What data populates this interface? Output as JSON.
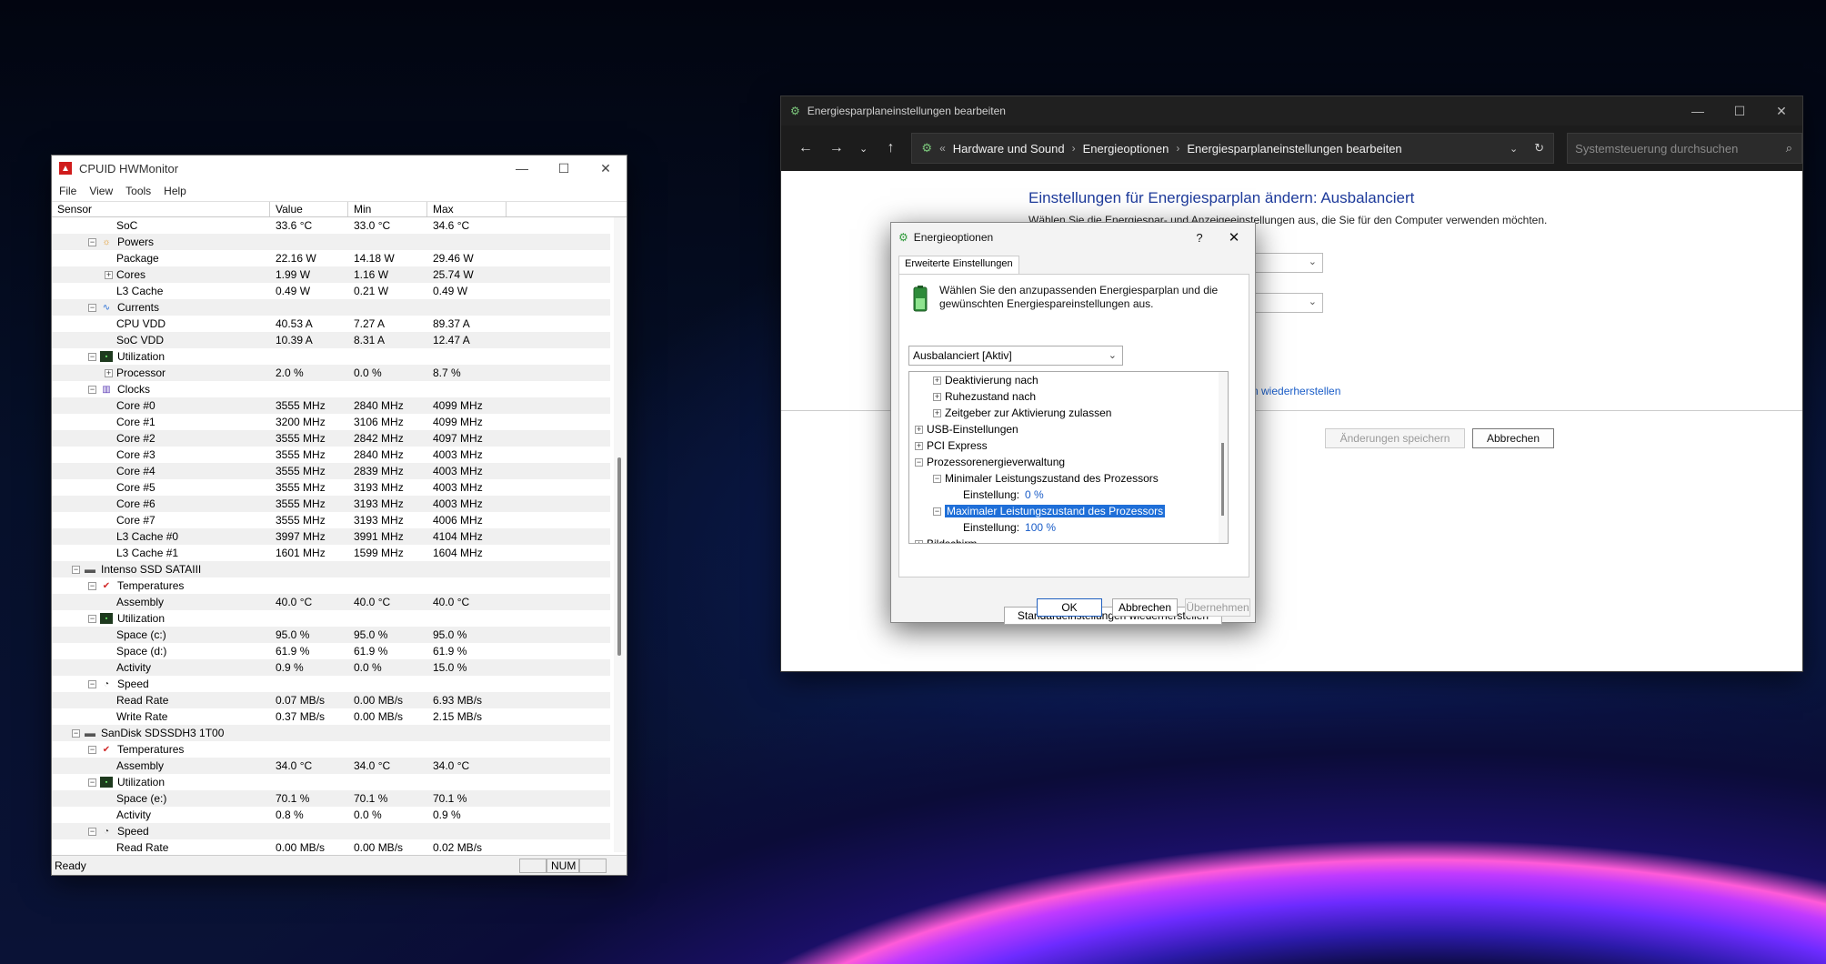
{
  "hwmonitor": {
    "title": "CPUID HWMonitor",
    "menu": [
      "File",
      "View",
      "Tools",
      "Help"
    ],
    "columns": [
      "Sensor",
      "Value",
      "Min",
      "Max"
    ],
    "rows": [
      {
        "indent": 3,
        "label": "SoC",
        "value": "33.6 °C",
        "min": "33.0 °C",
        "max": "34.6 °C"
      },
      {
        "indent": 2,
        "exp": "-",
        "icon": "powers-icon",
        "glyph": "☼",
        "cls": "pow",
        "label": "Powers",
        "value": "",
        "min": "",
        "max": ""
      },
      {
        "indent": 3,
        "label": "Package",
        "value": "22.16 W",
        "min": "14.18 W",
        "max": "29.46 W"
      },
      {
        "indent": 3,
        "exp": "+",
        "label": "Cores",
        "value": "1.99 W",
        "min": "1.16 W",
        "max": "25.74 W"
      },
      {
        "indent": 3,
        "label": "L3 Cache",
        "value": "0.49 W",
        "min": "0.21 W",
        "max": "0.49 W"
      },
      {
        "indent": 2,
        "exp": "-",
        "icon": "currents-icon",
        "glyph": "∿",
        "cls": "cur",
        "label": "Currents",
        "value": "",
        "min": "",
        "max": ""
      },
      {
        "indent": 3,
        "label": "CPU VDD",
        "value": "40.53 A",
        "min": "7.27 A",
        "max": "89.37 A"
      },
      {
        "indent": 3,
        "label": "SoC VDD",
        "value": "10.39 A",
        "min": "8.31 A",
        "max": "12.47 A"
      },
      {
        "indent": 2,
        "exp": "-",
        "icon": "utilization-icon",
        "glyph": "▪",
        "cls": "util",
        "label": "Utilization",
        "value": "",
        "min": "",
        "max": ""
      },
      {
        "indent": 3,
        "exp": "+",
        "label": "Processor",
        "value": "2.0 %",
        "min": "0.0 %",
        "max": "8.7 %"
      },
      {
        "indent": 2,
        "exp": "-",
        "icon": "clocks-icon",
        "glyph": "▥",
        "cls": "clk",
        "label": "Clocks",
        "value": "",
        "min": "",
        "max": ""
      },
      {
        "indent": 3,
        "label": "Core #0",
        "value": "3555 MHz",
        "min": "2840 MHz",
        "max": "4099 MHz"
      },
      {
        "indent": 3,
        "label": "Core #1",
        "value": "3200 MHz",
        "min": "3106 MHz",
        "max": "4099 MHz"
      },
      {
        "indent": 3,
        "label": "Core #2",
        "value": "3555 MHz",
        "min": "2842 MHz",
        "max": "4097 MHz"
      },
      {
        "indent": 3,
        "label": "Core #3",
        "value": "3555 MHz",
        "min": "2840 MHz",
        "max": "4003 MHz"
      },
      {
        "indent": 3,
        "label": "Core #4",
        "value": "3555 MHz",
        "min": "2839 MHz",
        "max": "4003 MHz"
      },
      {
        "indent": 3,
        "label": "Core #5",
        "value": "3555 MHz",
        "min": "3193 MHz",
        "max": "4003 MHz"
      },
      {
        "indent": 3,
        "label": "Core #6",
        "value": "3555 MHz",
        "min": "3193 MHz",
        "max": "4003 MHz"
      },
      {
        "indent": 3,
        "label": "Core #7",
        "value": "3555 MHz",
        "min": "3193 MHz",
        "max": "4006 MHz"
      },
      {
        "indent": 3,
        "label": "L3 Cache #0",
        "value": "3997 MHz",
        "min": "3991 MHz",
        "max": "4104 MHz"
      },
      {
        "indent": 3,
        "label": "L3 Cache #1",
        "value": "1601 MHz",
        "min": "1599 MHz",
        "max": "1604 MHz"
      },
      {
        "indent": 1,
        "exp": "-",
        "icon": "drive-icon",
        "glyph": "▬",
        "cls": "disk",
        "label": "Intenso SSD SATAIII",
        "value": "",
        "min": "",
        "max": ""
      },
      {
        "indent": 2,
        "exp": "-",
        "icon": "temperature-icon",
        "glyph": "✔",
        "cls": "temp",
        "label": "Temperatures",
        "value": "",
        "min": "",
        "max": ""
      },
      {
        "indent": 3,
        "label": "Assembly",
        "value": "40.0 °C",
        "min": "40.0 °C",
        "max": "40.0 °C"
      },
      {
        "indent": 2,
        "exp": "-",
        "icon": "utilization-icon",
        "glyph": "▪",
        "cls": "util",
        "label": "Utilization",
        "value": "",
        "min": "",
        "max": ""
      },
      {
        "indent": 3,
        "label": "Space (c:)",
        "value": "95.0 %",
        "min": "95.0 %",
        "max": "95.0 %"
      },
      {
        "indent": 3,
        "label": "Space (d:)",
        "value": "61.9 %",
        "min": "61.9 %",
        "max": "61.9 %"
      },
      {
        "indent": 3,
        "label": "Activity",
        "value": "0.9 %",
        "min": "0.0 %",
        "max": "15.0 %"
      },
      {
        "indent": 2,
        "exp": "-",
        "icon": "speed-icon",
        "glyph": "◔",
        "cls": "spd",
        "label": "Speed",
        "value": "",
        "min": "",
        "max": ""
      },
      {
        "indent": 3,
        "label": "Read Rate",
        "value": "0.07 MB/s",
        "min": "0.00 MB/s",
        "max": "6.93 MB/s"
      },
      {
        "indent": 3,
        "label": "Write Rate",
        "value": "0.37 MB/s",
        "min": "0.00 MB/s",
        "max": "2.15 MB/s"
      },
      {
        "indent": 1,
        "exp": "-",
        "icon": "drive-icon",
        "glyph": "▬",
        "cls": "disk",
        "label": "SanDisk SDSSDH3 1T00",
        "value": "",
        "min": "",
        "max": ""
      },
      {
        "indent": 2,
        "exp": "-",
        "icon": "temperature-icon",
        "glyph": "✔",
        "cls": "temp",
        "label": "Temperatures",
        "value": "",
        "min": "",
        "max": ""
      },
      {
        "indent": 3,
        "label": "Assembly",
        "value": "34.0 °C",
        "min": "34.0 °C",
        "max": "34.0 °C"
      },
      {
        "indent": 2,
        "exp": "-",
        "icon": "utilization-icon",
        "glyph": "▪",
        "cls": "util",
        "label": "Utilization",
        "value": "",
        "min": "",
        "max": ""
      },
      {
        "indent": 3,
        "label": "Space (e:)",
        "value": "70.1 %",
        "min": "70.1 %",
        "max": "70.1 %"
      },
      {
        "indent": 3,
        "label": "Activity",
        "value": "0.8 %",
        "min": "0.0 %",
        "max": "0.9 %"
      },
      {
        "indent": 2,
        "exp": "-",
        "icon": "speed-icon",
        "glyph": "◔",
        "cls": "spd",
        "label": "Speed",
        "value": "",
        "min": "",
        "max": ""
      },
      {
        "indent": 3,
        "label": "Read Rate",
        "value": "0.00 MB/s",
        "min": "0.00 MB/s",
        "max": "0.02 MB/s"
      }
    ],
    "status": "Ready",
    "num": "NUM"
  },
  "controlpanel": {
    "title": "Energiesparplaneinstellungen bearbeiten",
    "breadcrumb": [
      "Hardware und Sound",
      "Energieoptionen",
      "Energiesparplaneinstellungen bearbeiten"
    ],
    "search_placeholder": "Systemsteuerung durchsuchen",
    "heading": "Einstellungen für Energiesparplan ändern: Ausbalanciert",
    "subtext": "Wählen Sie die Energiespar- und Anzeigeeinstellungen aus, die Sie für den Computer verwenden möchten.",
    "restore_link": "n wiederherstellen",
    "save_label": "Änderungen speichern",
    "cancel_label": "Abbrechen"
  },
  "dialog": {
    "title": "Energieoptionen",
    "help": "?",
    "tab": "Erweiterte Einstellungen",
    "description": "Wählen Sie den anzupassenden Energiesparplan und die gewünschten Energiespareinstellungen aus.",
    "plan": "Ausbalanciert [Aktiv]",
    "tree": [
      {
        "indent": 1,
        "exp": "+",
        "label": "Deaktivierung nach"
      },
      {
        "indent": 1,
        "exp": "+",
        "label": "Ruhezustand nach"
      },
      {
        "indent": 1,
        "exp": "+",
        "label": "Zeitgeber zur Aktivierung zulassen"
      },
      {
        "indent": 0,
        "exp": "+",
        "label": "USB-Einstellungen"
      },
      {
        "indent": 0,
        "exp": "+",
        "label": "PCI Express"
      },
      {
        "indent": 0,
        "exp": "-",
        "label": "Prozessorenergieverwaltung"
      },
      {
        "indent": 1,
        "exp": "-",
        "label": "Minimaler Leistungszustand des Prozessors"
      },
      {
        "indent": 2,
        "label": "Einstellung:",
        "value": "0 %"
      },
      {
        "indent": 1,
        "exp": "-",
        "label": "Maximaler Leistungszustand des Prozessors",
        "selected": true
      },
      {
        "indent": 2,
        "label": "Einstellung:",
        "value": "100 %"
      },
      {
        "indent": 0,
        "exp": "+",
        "label": "Bildschirm"
      }
    ],
    "restore_defaults": "Standardeinstellungen wiederherstellen",
    "ok": "OK",
    "cancel": "Abbrechen",
    "apply": "Übernehmen"
  }
}
